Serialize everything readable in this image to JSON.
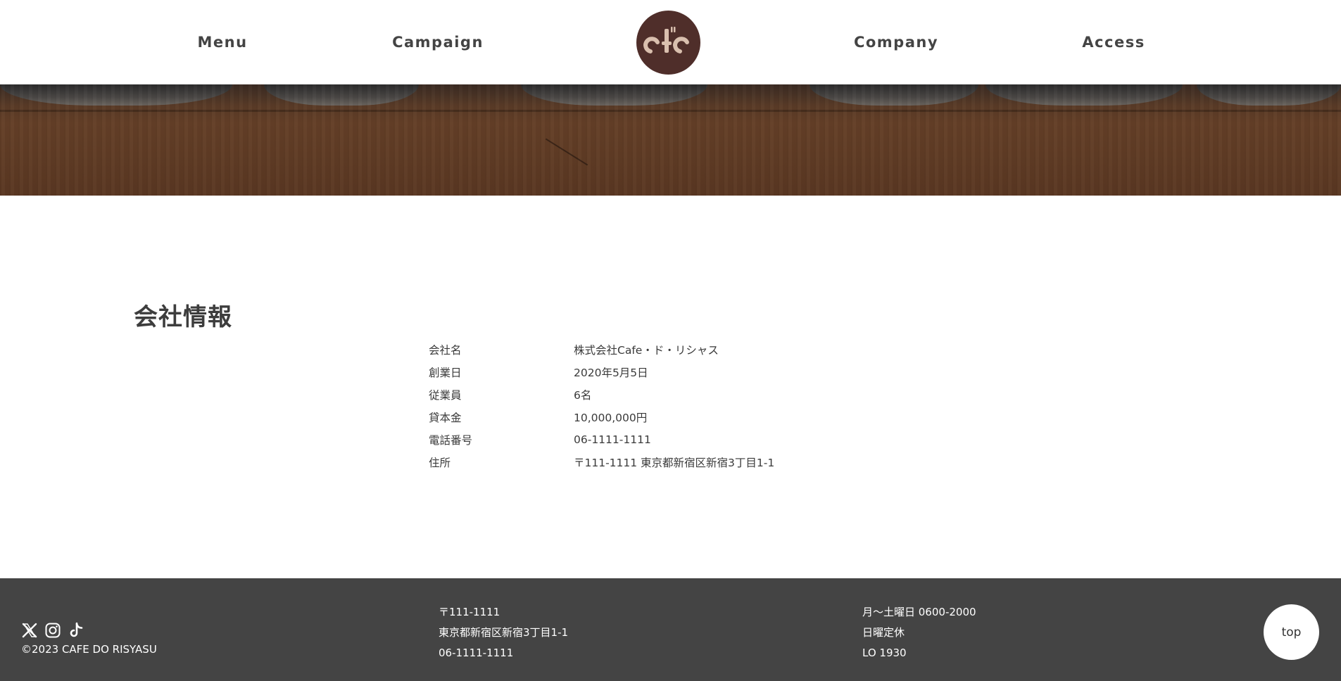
{
  "header": {
    "nav": [
      {
        "label": "Menu"
      },
      {
        "label": "Campaign"
      },
      {
        "label": "Company"
      },
      {
        "label": "Access"
      }
    ],
    "logo": {
      "icon": "cafe-logo",
      "color": "#4f2e2a",
      "accent": "#d9bfae"
    }
  },
  "hero": {
    "description_color": "#603c25"
  },
  "company": {
    "title": "会社情報",
    "rows": [
      {
        "label": "会社名",
        "value": "株式会社Cafe・ド・リシャス"
      },
      {
        "label": "創業日",
        "value": "2020年5月5日"
      },
      {
        "label": "従業員",
        "value": "6名"
      },
      {
        "label": "貸本金",
        "value": "10,000,000円"
      },
      {
        "label": "電話番号",
        "value": "06-1111-1111"
      },
      {
        "label": "住所",
        "value": "〒111-1111 東京都新宿区新宿3丁目1-1"
      }
    ]
  },
  "footer": {
    "social": [
      {
        "icon": "x-icon"
      },
      {
        "icon": "instagram-icon"
      },
      {
        "icon": "tiktok-icon"
      }
    ],
    "copyright": "©2023 CAFE DO RISYASU",
    "address": {
      "postal": "〒111-1111",
      "street": "東京都新宿区新宿3丁目1-1",
      "phone": "06-1111-1111"
    },
    "hours": {
      "weekdays": "月〜土曜日 0600-2000",
      "closed": "日曜定休",
      "last_order": "LO 1930"
    },
    "top_button": "top",
    "background": "#444444"
  }
}
